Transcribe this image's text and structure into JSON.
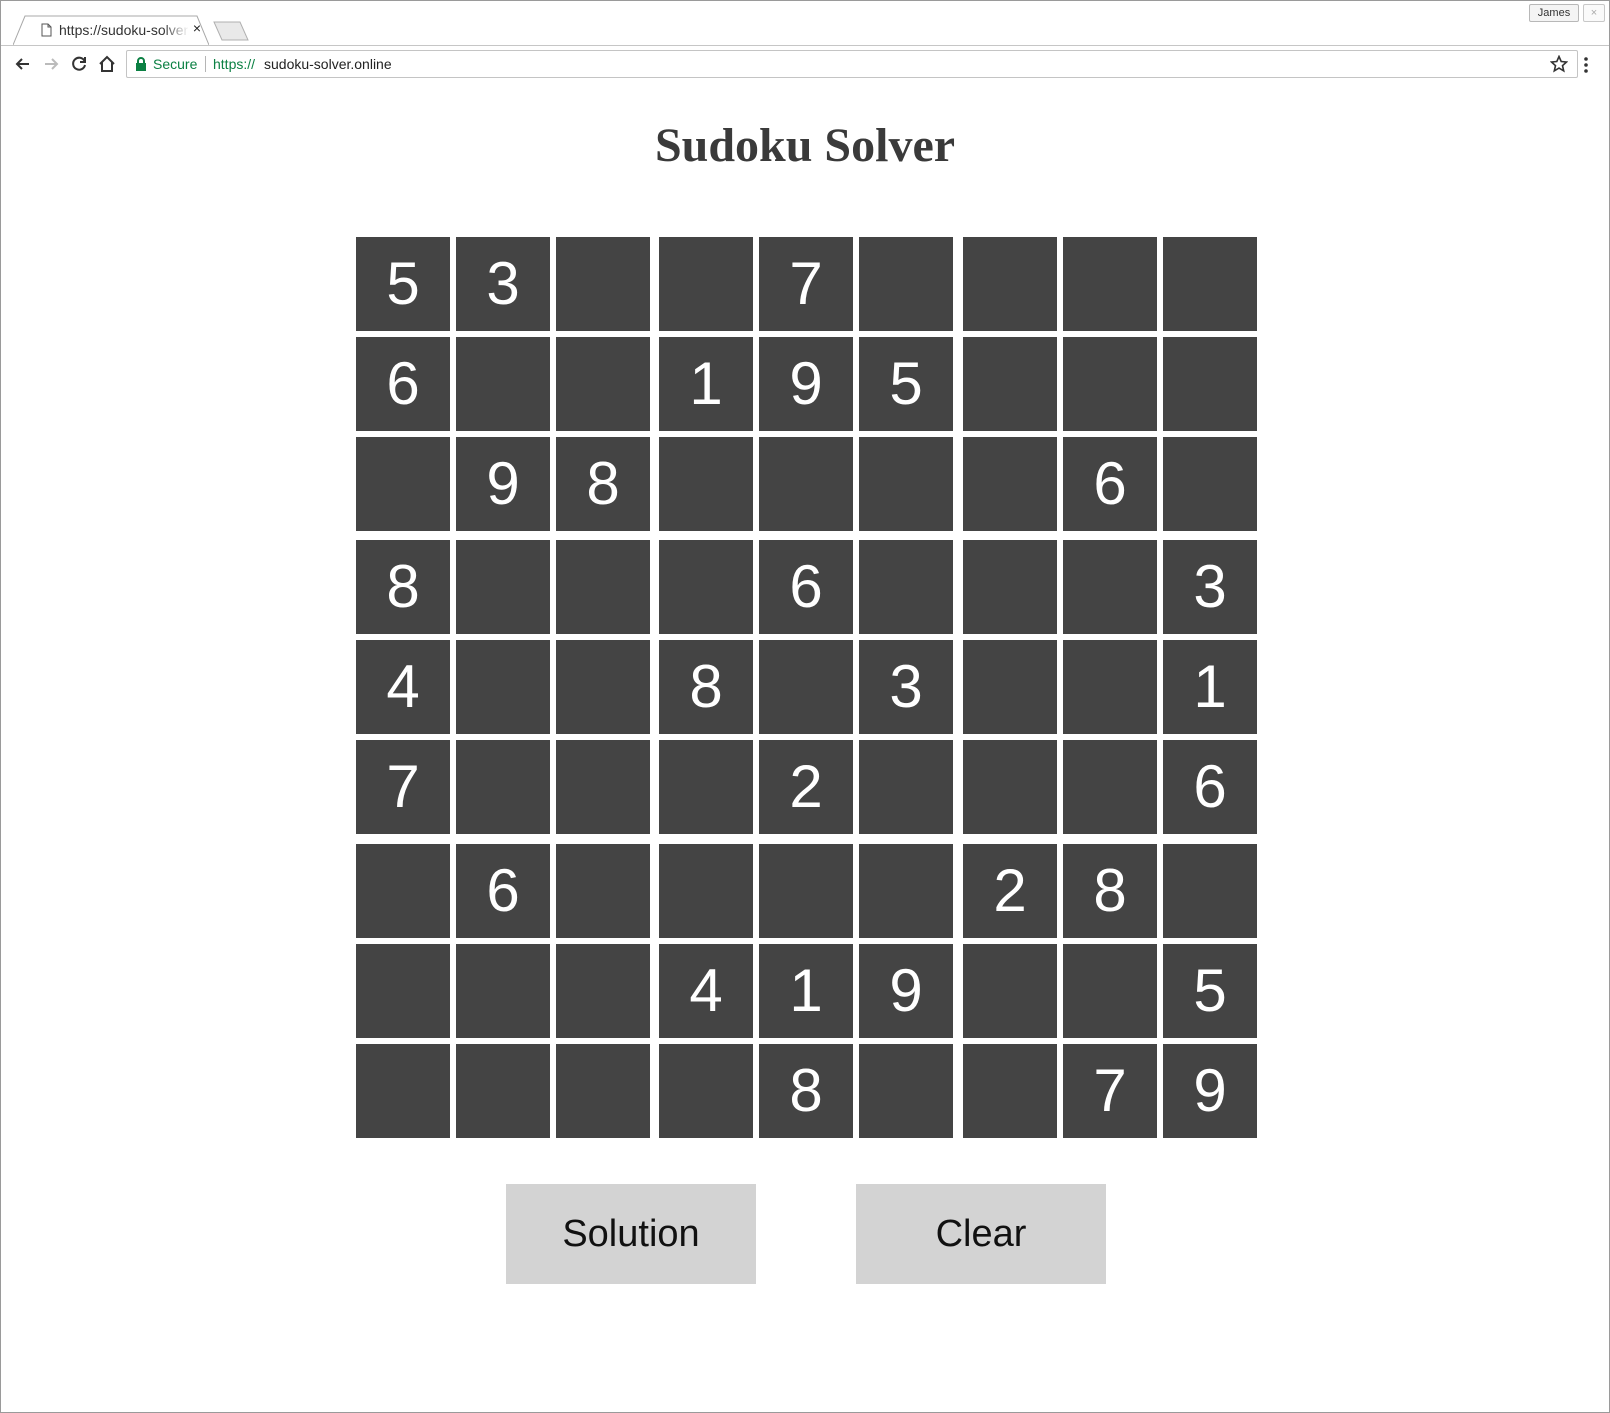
{
  "browser": {
    "tab": {
      "title": "https://sudoku-solver.online",
      "close_glyph": "×"
    },
    "profile_name": "James",
    "window_close_glyph": "×",
    "address_bar": {
      "security_label": "Secure",
      "url_scheme": "https://",
      "url_host": "sudoku-solver.online"
    },
    "icons": {
      "back": "back-arrow-icon",
      "forward": "forward-arrow-icon",
      "reload": "reload-icon",
      "home": "home-icon",
      "lock": "lock-icon",
      "star": "star-icon",
      "menu": "kebab-menu-icon",
      "favicon": "page-icon"
    }
  },
  "page": {
    "title": "Sudoku Solver",
    "grid": [
      [
        "5",
        "3",
        "",
        "",
        "7",
        "",
        "",
        "",
        ""
      ],
      [
        "6",
        "",
        "",
        "1",
        "9",
        "5",
        "",
        "",
        ""
      ],
      [
        "",
        "9",
        "8",
        "",
        "",
        "",
        "",
        "6",
        ""
      ],
      [
        "8",
        "",
        "",
        "",
        "6",
        "",
        "",
        "",
        "3"
      ],
      [
        "4",
        "",
        "",
        "8",
        "",
        "3",
        "",
        "",
        "1"
      ],
      [
        "7",
        "",
        "",
        "",
        "2",
        "",
        "",
        "",
        "6"
      ],
      [
        "",
        "6",
        "",
        "",
        "",
        "",
        "2",
        "8",
        ""
      ],
      [
        "",
        "",
        "",
        "4",
        "1",
        "9",
        "",
        "",
        "5"
      ],
      [
        "",
        "",
        "",
        "",
        "8",
        "",
        "",
        "7",
        "9"
      ]
    ],
    "buttons": {
      "solution": "Solution",
      "clear": "Clear"
    }
  },
  "colors": {
    "cell_background": "#444444",
    "cell_text": "#ffffff",
    "button_background": "#d3d3d3",
    "secure_green": "#0b8043",
    "title_text": "#3a3a3a"
  }
}
